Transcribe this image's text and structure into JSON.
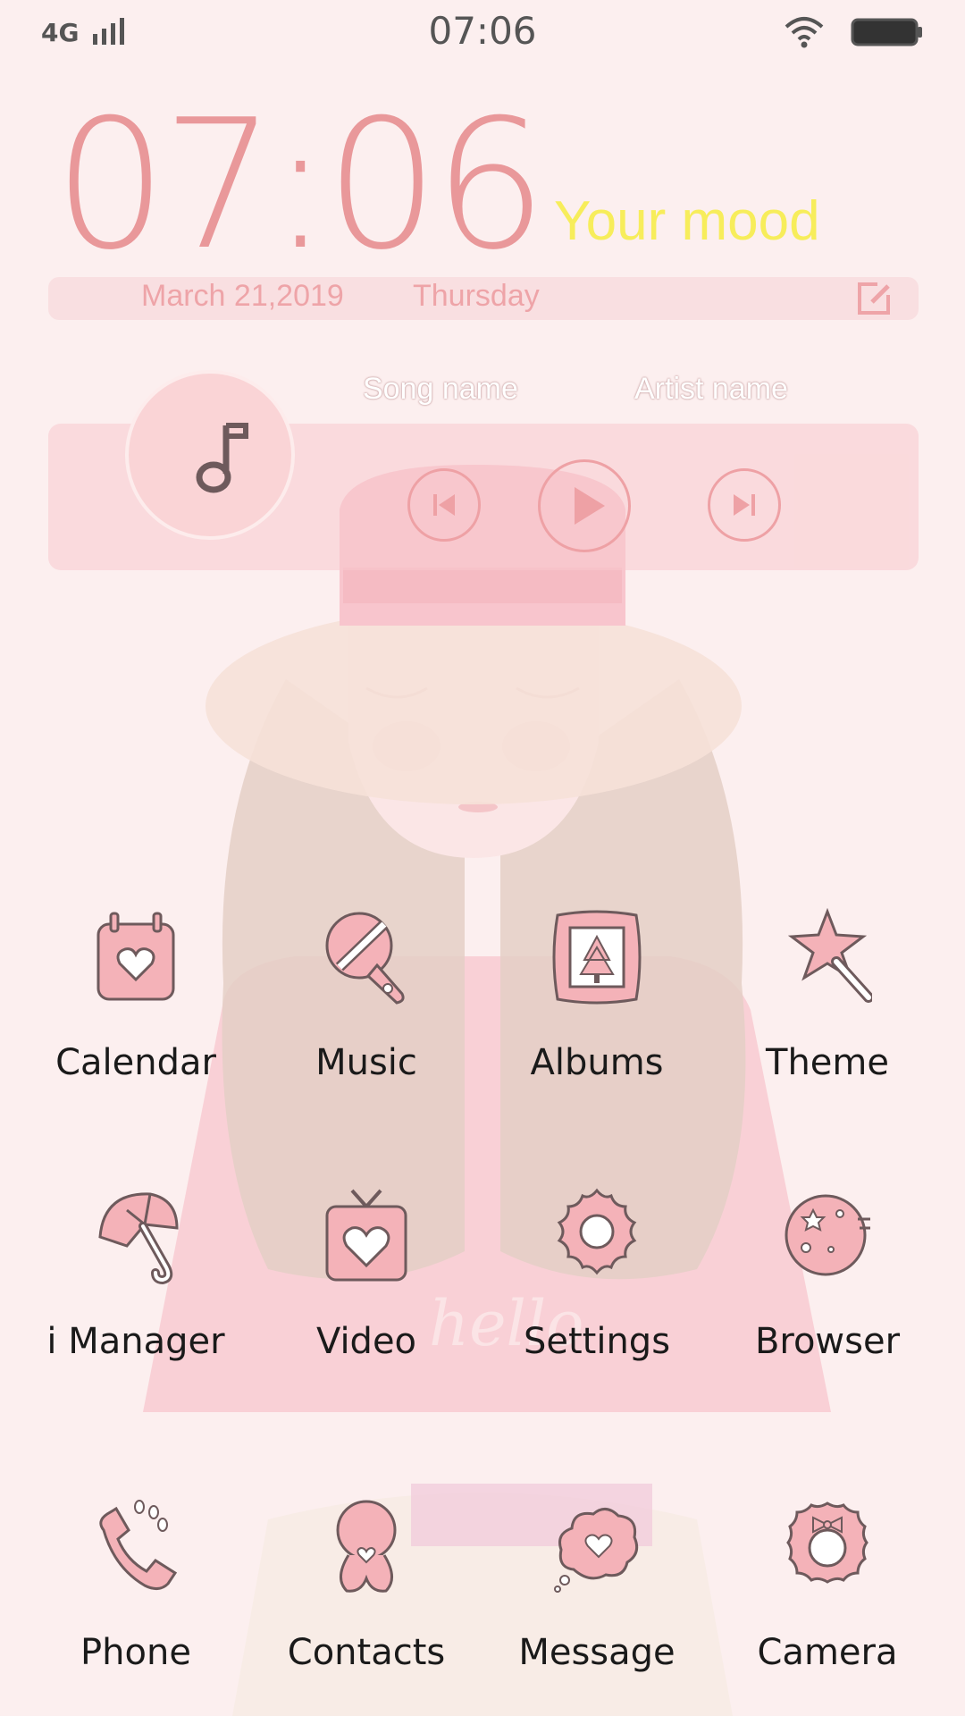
{
  "status_bar": {
    "network": "4G",
    "time": "07:06"
  },
  "clock_widget": {
    "time": "07:06",
    "mood": "Your mood",
    "date": "March 21,2019",
    "day": "Thursday"
  },
  "music_widget": {
    "song_name": "Song name",
    "artist_name": "Artist name"
  },
  "apps": [
    {
      "label": "Calendar",
      "icon": "calendar-icon"
    },
    {
      "label": "Music",
      "icon": "microphone-icon"
    },
    {
      "label": "Albums",
      "icon": "picture-frame-icon"
    },
    {
      "label": "Theme",
      "icon": "star-wand-icon"
    },
    {
      "label": "i Manager",
      "icon": "umbrella-icon"
    },
    {
      "label": "Video",
      "icon": "tv-heart-icon"
    },
    {
      "label": "Settings",
      "icon": "gear-icon"
    },
    {
      "label": "Browser",
      "icon": "planet-icon"
    },
    {
      "label": "Phone",
      "icon": "phone-icon"
    },
    {
      "label": "Contacts",
      "icon": "person-heart-icon"
    },
    {
      "label": "Message",
      "icon": "cloud-heart-icon"
    },
    {
      "label": "Camera",
      "icon": "bow-camera-icon"
    }
  ],
  "colors": {
    "background": "#fcefef",
    "accent_pink": "#e9989a",
    "mood_yellow": "#f7ed5b",
    "icon_fill": "#f4b2b8",
    "icon_stroke": "#6e5a5c"
  }
}
